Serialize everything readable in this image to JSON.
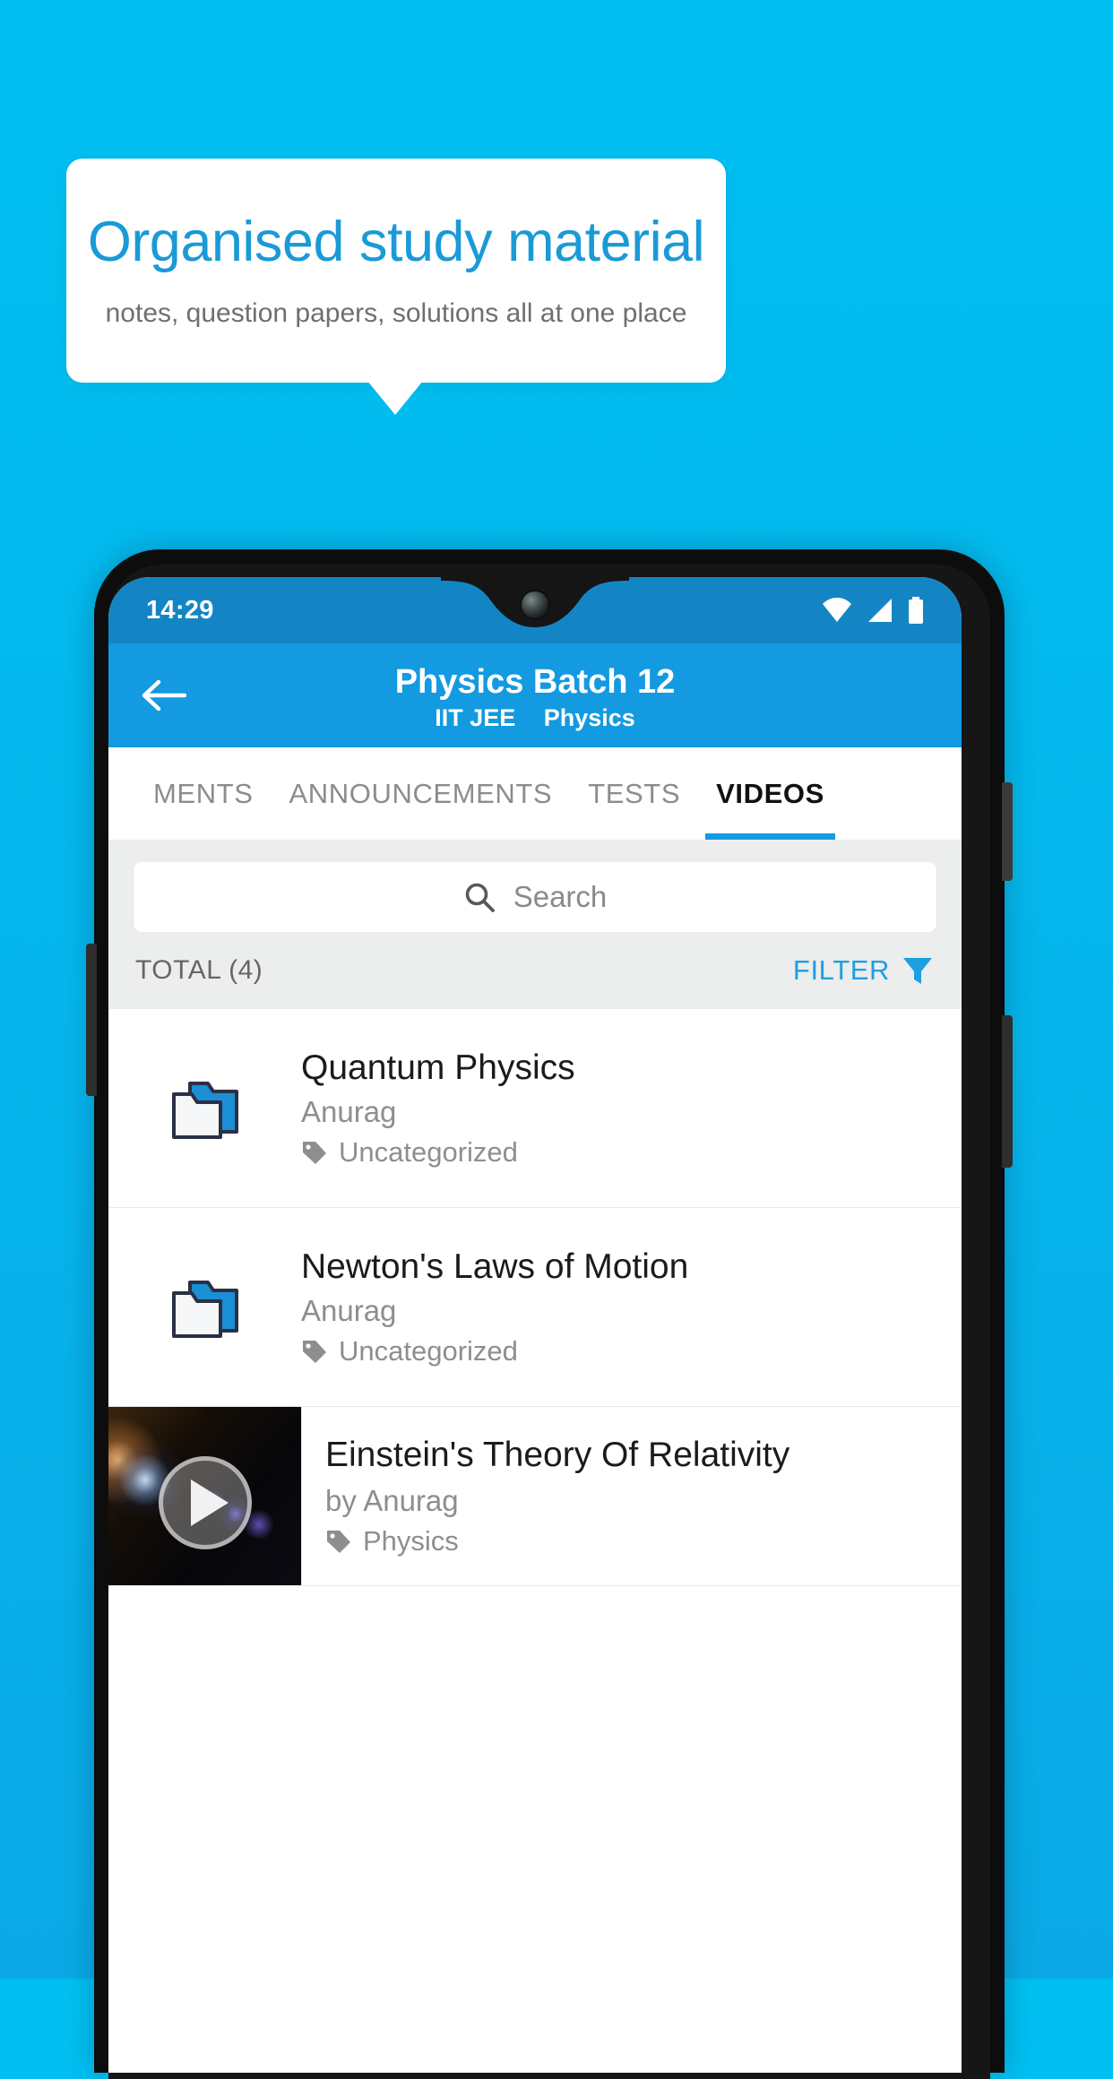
{
  "promo": {
    "title": "Organised study material",
    "subtitle": "notes, question papers, solutions all at one place"
  },
  "colors": {
    "background_top": "#00c0f2",
    "background_bottom": "#0aa9e6",
    "accent": "#139ae0",
    "promo_title": "#1a9ad7",
    "status_bar": "#1485c4",
    "filter_blue": "#1e9fe0"
  },
  "phone": {
    "status_bar": {
      "time": "14:29",
      "icons": [
        "wifi-icon",
        "signal-icon",
        "battery-icon"
      ]
    },
    "app_bar": {
      "back_icon": "back-arrow-icon",
      "title": "Physics Batch 12",
      "subtitle_course": "IIT JEE",
      "subtitle_subject": "Physics"
    },
    "tabs": [
      {
        "label": "MENTS",
        "active": false
      },
      {
        "label": "ANNOUNCEMENTS",
        "active": false
      },
      {
        "label": "TESTS",
        "active": false
      },
      {
        "label": "VIDEOS",
        "active": true
      }
    ],
    "search": {
      "icon": "search-icon",
      "placeholder": "Search",
      "value": ""
    },
    "toolbar": {
      "total_label": "TOTAL (4)",
      "filter_label": "FILTER",
      "filter_icon": "funnel-icon"
    },
    "list": [
      {
        "type": "folder",
        "icon": "folder-icon",
        "title": "Quantum Physics",
        "author": "Anurag",
        "tag_icon": "tag-icon",
        "tag": "Uncategorized"
      },
      {
        "type": "folder",
        "icon": "folder-icon",
        "title": "Newton's Laws of Motion",
        "author": "Anurag",
        "tag_icon": "tag-icon",
        "tag": "Uncategorized"
      },
      {
        "type": "video",
        "icon": "play-icon",
        "title": "Einstein's Theory Of Relativity",
        "author": "by Anurag",
        "tag_icon": "tag-icon",
        "tag": "Physics"
      }
    ]
  }
}
